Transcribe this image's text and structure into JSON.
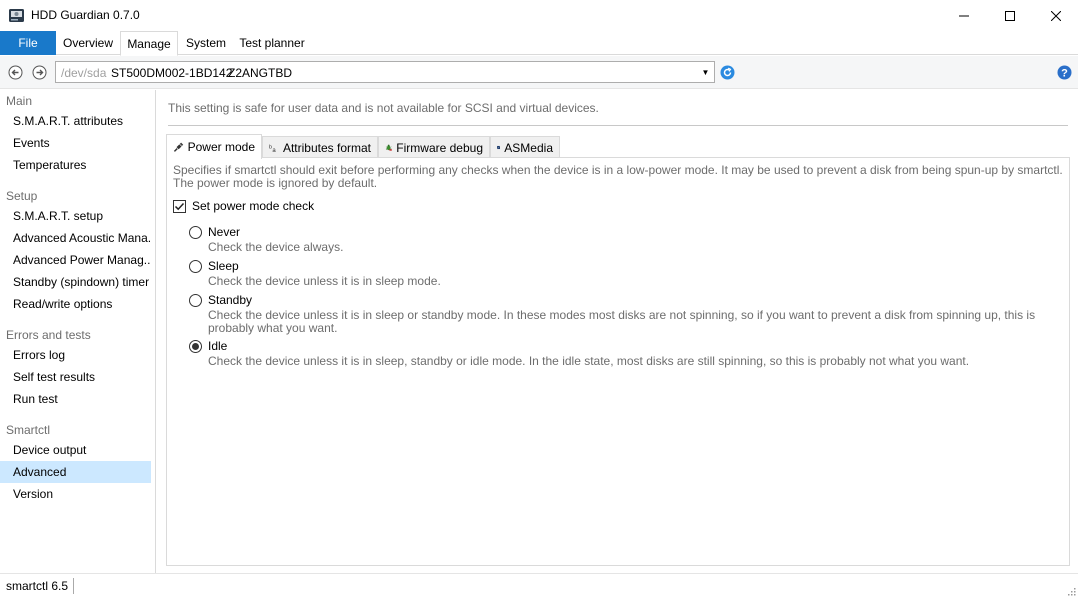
{
  "window": {
    "title": "HDD Guardian 0.7.0"
  },
  "menu": {
    "file": "File",
    "tabs": [
      "Overview",
      "Manage",
      "System",
      "Test planner"
    ],
    "active_tab": "Manage"
  },
  "address": {
    "device_path": "/dev/sda",
    "model": "ST500DM002-1BD142",
    "serial": "Z2ANGTBD"
  },
  "sidebar": {
    "groups": [
      {
        "title": "Main",
        "items": [
          "S.M.A.R.T. attributes",
          "Events",
          "Temperatures"
        ]
      },
      {
        "title": "Setup",
        "items": [
          "S.M.A.R.T. setup",
          "Advanced Acoustic Mana...",
          "Advanced Power Manag...",
          "Standby (spindown) timer",
          "Read/write options"
        ]
      },
      {
        "title": "Errors and tests",
        "items": [
          "Errors log",
          "Self test results",
          "Run test"
        ]
      },
      {
        "title": "Smartctl",
        "items": [
          "Device output",
          "Advanced",
          "Version"
        ]
      }
    ],
    "selected": "Advanced"
  },
  "content": {
    "note": "This setting is safe for user data and is not available for SCSI and virtual devices.",
    "tabs": [
      "Power mode",
      "Attributes format",
      "Firmware debug",
      "ASMedia"
    ],
    "active_tab": "Power mode",
    "description": "Specifies if smartctl should exit before performing any checks when the device is in a low-power mode. It may be used to prevent a disk from being spun-up by smartctl. The power mode is ignored by default.",
    "checkbox": {
      "label": "Set power mode check",
      "checked": true
    },
    "options": [
      {
        "label": "Never",
        "desc": "Check the device always.",
        "selected": false
      },
      {
        "label": "Sleep",
        "desc": "Check the device unless it is in sleep mode.",
        "selected": false
      },
      {
        "label": "Standby",
        "desc": "Check the device unless it is in sleep or standby mode. In these modes most disks are not spinning, so if you want to prevent a disk from spinning up, this is probably what you want.",
        "selected": false
      },
      {
        "label": "Idle",
        "desc": "Check the device unless it is in sleep, standby or idle mode. In the idle state, most disks are still spinning, so this is probably not what you want.",
        "selected": true
      }
    ]
  },
  "status": {
    "text": "smartctl 6.5"
  },
  "colors": {
    "accent": "#1979ca",
    "selection": "#cce8ff",
    "muted_text": "#6d6d6d"
  },
  "icons": {
    "app": "hard-drive-icon",
    "back": "back-arrow-icon",
    "forward": "forward-arrow-icon",
    "refresh": "refresh-icon",
    "help": "help-icon",
    "power_tab": "plug-icon",
    "attributes_tab": "text-format-icon",
    "firmware_tab": "bug-icon",
    "asmedia_tab": "asmedia-logo-icon"
  }
}
